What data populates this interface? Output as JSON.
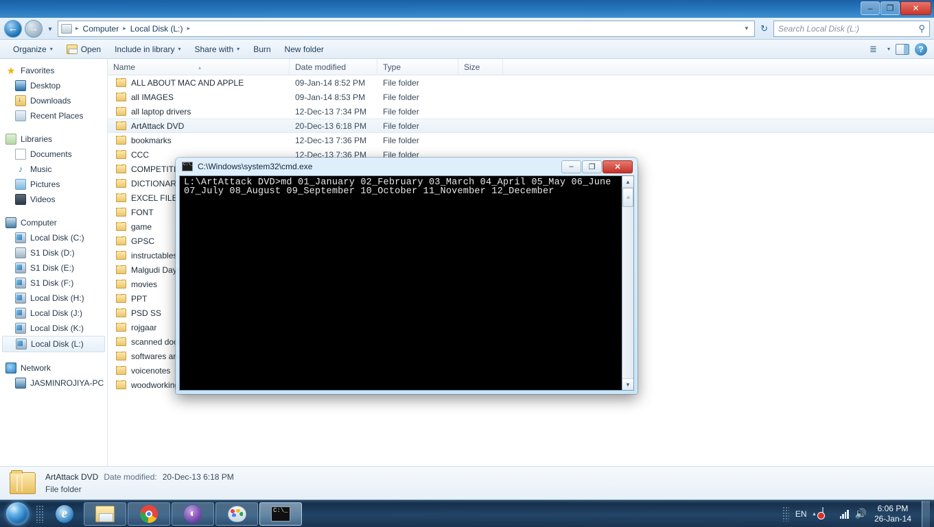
{
  "window": {
    "minimize_label": "–",
    "maximize_label": "❐",
    "close_label": "✕"
  },
  "address": {
    "back_label": "←",
    "forward_label": "→",
    "history_caret": "▾",
    "crumbs": [
      "Computer",
      "Local Disk (L:)"
    ],
    "separator": "▸",
    "dropdown_caret": "▾",
    "refresh_label": "↻"
  },
  "search": {
    "placeholder": "Search Local Disk (L:)",
    "icon": "⚲"
  },
  "toolbar": {
    "organize_label": "Organize",
    "open_label": "Open",
    "include_label": "Include in library",
    "share_label": "Share with",
    "burn_label": "Burn",
    "newfolder_label": "New folder",
    "caret": "▾",
    "view_icon": "≣",
    "help_label": "?"
  },
  "sidebar": {
    "groups": [
      {
        "header": {
          "label": "Favorites",
          "icon": "star-icon"
        },
        "items": [
          {
            "label": "Desktop",
            "icon": "desktop-icon"
          },
          {
            "label": "Downloads",
            "icon": "downloads-icon"
          },
          {
            "label": "Recent Places",
            "icon": "recent-places-icon"
          }
        ]
      },
      {
        "header": {
          "label": "Libraries",
          "icon": "libraries-icon"
        },
        "items": [
          {
            "label": "Documents",
            "icon": "documents-icon"
          },
          {
            "label": "Music",
            "icon": "music-icon"
          },
          {
            "label": "Pictures",
            "icon": "pictures-icon"
          },
          {
            "label": "Videos",
            "icon": "videos-icon"
          }
        ]
      },
      {
        "header": {
          "label": "Computer",
          "icon": "computer-icon"
        },
        "items": [
          {
            "label": "Local Disk (C:)",
            "icon": "windows-drive-icon"
          },
          {
            "label": "S1 Disk (D:)",
            "icon": "drive-icon"
          },
          {
            "label": "S1 Disk (E:)",
            "icon": "drive-icon"
          },
          {
            "label": "S1 Disk (F:)",
            "icon": "drive-icon"
          },
          {
            "label": "Local Disk (H:)",
            "icon": "drive-icon"
          },
          {
            "label": "Local Disk (J:)",
            "icon": "drive-icon"
          },
          {
            "label": "Local Disk (K:)",
            "icon": "drive-icon"
          },
          {
            "label": "Local Disk (L:)",
            "icon": "drive-icon",
            "selected": true
          }
        ]
      },
      {
        "header": {
          "label": "Network",
          "icon": "network-icon"
        },
        "items": [
          {
            "label": "JASMINROJIYA-PC",
            "icon": "computer-node-icon"
          }
        ]
      }
    ]
  },
  "filelist": {
    "columns": [
      "Name",
      "Date modified",
      "Type",
      "Size"
    ],
    "sort_column": "Name",
    "sort_marker": "▴",
    "rows": [
      {
        "name": "ALL ABOUT MAC AND APPLE",
        "date": "09-Jan-14 8:52 PM",
        "type": "File folder",
        "size": ""
      },
      {
        "name": "all IMAGES",
        "date": "09-Jan-14 8:53 PM",
        "type": "File folder",
        "size": ""
      },
      {
        "name": "all laptop drivers",
        "date": "12-Dec-13 7:34 PM",
        "type": "File folder",
        "size": ""
      },
      {
        "name": "ArtAttack DVD",
        "date": "20-Dec-13 6:18 PM",
        "type": "File folder",
        "size": "",
        "selected": true
      },
      {
        "name": "bookmarks",
        "date": "12-Dec-13 7:36 PM",
        "type": "File folder",
        "size": ""
      },
      {
        "name": "CCC",
        "date": "12-Dec-13 7:36 PM",
        "type": "File folder",
        "size": ""
      },
      {
        "name": "COMPETITION",
        "date": "",
        "type": "",
        "size": ""
      },
      {
        "name": "DICTIONARY",
        "date": "",
        "type": "",
        "size": ""
      },
      {
        "name": "EXCEL FILES",
        "date": "",
        "type": "",
        "size": ""
      },
      {
        "name": "FONT",
        "date": "",
        "type": "",
        "size": ""
      },
      {
        "name": "game",
        "date": "",
        "type": "",
        "size": ""
      },
      {
        "name": "GPSC",
        "date": "",
        "type": "",
        "size": ""
      },
      {
        "name": "instructables",
        "date": "",
        "type": "",
        "size": ""
      },
      {
        "name": "Malgudi Days",
        "date": "",
        "type": "",
        "size": ""
      },
      {
        "name": "movies",
        "date": "",
        "type": "",
        "size": ""
      },
      {
        "name": "PPT",
        "date": "",
        "type": "",
        "size": ""
      },
      {
        "name": "PSD SS",
        "date": "",
        "type": "",
        "size": ""
      },
      {
        "name": "rojgaar",
        "date": "",
        "type": "",
        "size": ""
      },
      {
        "name": "scanned documents",
        "date": "",
        "type": "",
        "size": ""
      },
      {
        "name": "softwares and setups",
        "date": "",
        "type": "",
        "size": ""
      },
      {
        "name": "voicenotes",
        "date": "",
        "type": "",
        "size": ""
      },
      {
        "name": "woodworking",
        "date": "",
        "type": "",
        "size": ""
      }
    ]
  },
  "details_pane": {
    "name": "ArtAttack DVD",
    "date_label": "Date modified:",
    "date_value": "20-Dec-13 6:18 PM",
    "type": "File folder"
  },
  "cmd": {
    "title": "C:\\Windows\\system32\\cmd.exe",
    "minimize_label": "–",
    "maximize_label": "❐",
    "close_label": "✕",
    "screen_text": "L:\\ArtAttack DVD>md 01_January 02_February 03_March 04_April 05_May 06_June 07_July 08_August 09_September 10_October 11_November 12_December",
    "scroll_up": "▲",
    "scroll_down": "▼",
    "thumb_glyph": "≡"
  },
  "taskbar": {
    "start_label": "Start",
    "buttons": [
      {
        "name": "internet-explorer",
        "label": "Internet Explorer"
      },
      {
        "name": "windows-explorer",
        "label": "Windows Explorer"
      },
      {
        "name": "google-chrome",
        "label": "Google Chrome"
      },
      {
        "name": "bittorrent",
        "label": "BitTorrent"
      },
      {
        "name": "paint",
        "label": "Paint"
      },
      {
        "name": "command-prompt",
        "label": "cmd.exe"
      }
    ],
    "cmd_glyph": "C:\\_",
    "tray": {
      "language": "EN",
      "show_hidden": "▴",
      "time": "6:06 PM",
      "date": "26-Jan-14"
    }
  },
  "colors": {
    "accent": "#1f6fb5",
    "selection": "#e9f1f8",
    "cmd_background": "#000000",
    "cmd_text": "#e8e8e8",
    "close_button": "#c4322a"
  }
}
